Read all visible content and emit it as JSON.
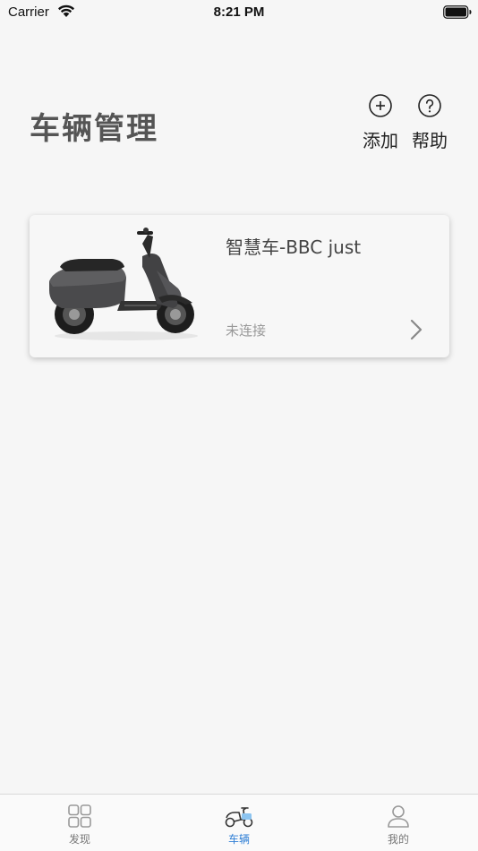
{
  "status_bar": {
    "carrier": "Carrier",
    "time": "8:21 PM"
  },
  "header": {
    "title": "车辆管理",
    "add_label": "添加",
    "help_label": "帮助",
    "add_icon": "plus-circle-icon",
    "help_icon": "question-circle-icon"
  },
  "vehicles": [
    {
      "name": "智慧车-BBC just",
      "status": "未连接",
      "image": "electric-scooter"
    }
  ],
  "tab_bar": {
    "active_color": "#2f7fd6",
    "inactive_color": "#777777",
    "tabs": [
      {
        "label": "发现",
        "icon": "grid-icon",
        "active": false
      },
      {
        "label": "车辆",
        "icon": "scooter-icon",
        "active": true
      },
      {
        "label": "我的",
        "icon": "person-icon",
        "active": false
      }
    ]
  }
}
